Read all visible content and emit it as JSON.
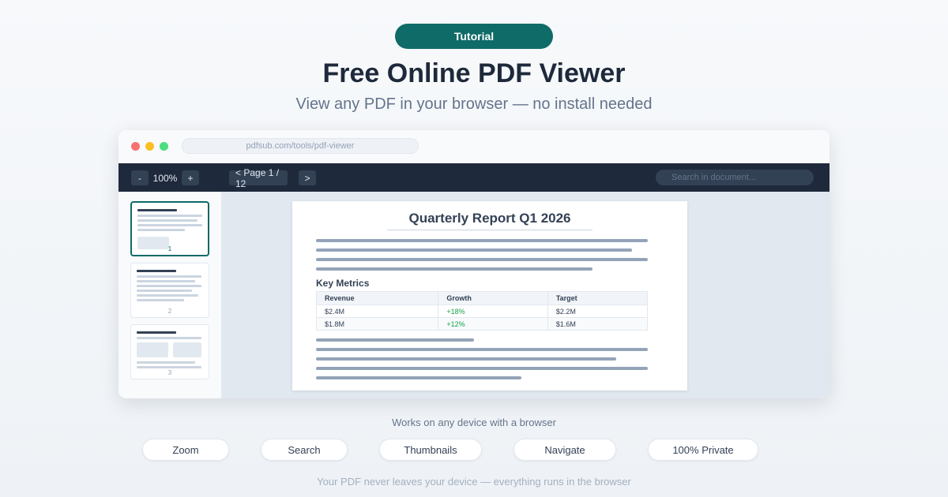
{
  "badge": "Tutorial",
  "title": "Free Online PDF Viewer",
  "subtitle": "View any PDF in your browser — no install needed",
  "browser": {
    "url": "pdfsub.com/tools/pdf-viewer"
  },
  "toolbar": {
    "zoom_out": "-",
    "zoom_level": "100%",
    "zoom_in": "+",
    "page_prev": "< Page 1 / 12",
    "page_next": ">",
    "search_placeholder": "Search in document..."
  },
  "thumbnails": [
    {
      "number": "1"
    },
    {
      "number": "2"
    },
    {
      "number": "3"
    }
  ],
  "document": {
    "title": "Quarterly Report Q1 2026",
    "section": "Key Metrics",
    "table": {
      "headers": [
        "Revenue",
        "Growth",
        "Target"
      ],
      "rows": [
        [
          "$2.4M",
          "+18%",
          "$2.2M"
        ],
        [
          "$1.8M",
          "+12%",
          "$1.6M"
        ]
      ]
    }
  },
  "works_text": "Works on any device with a browser",
  "features": [
    "Zoom",
    "Search",
    "Thumbnails",
    "Navigate",
    "100% Private"
  ],
  "footer": "Your PDF never leaves your device — everything runs in the browser",
  "colors": {
    "accent": "#0f6b68",
    "toolbar": "#1e293b",
    "growth": "#16a34a"
  }
}
